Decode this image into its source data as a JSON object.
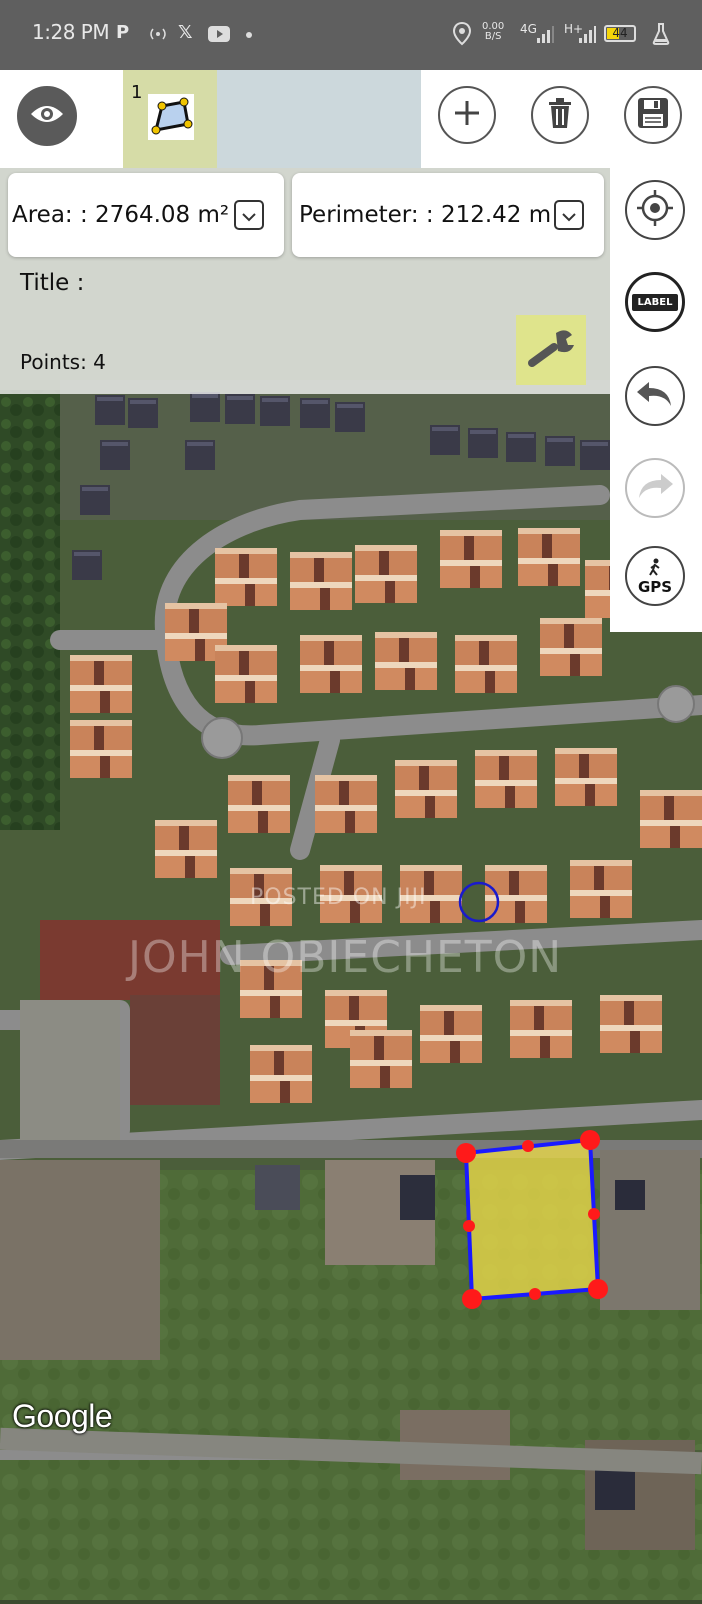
{
  "status_bar": {
    "time": "1:28 PM",
    "icons": [
      "p-app-icon",
      "radio-icon",
      "x-icon",
      "youtube-icon",
      "dot-icon"
    ],
    "net_speed_value": "0.00",
    "net_speed_unit": "B/S",
    "network": "4G",
    "network2": "H+",
    "battery": "44"
  },
  "toolbar": {
    "shape_number": "1"
  },
  "info": {
    "area": "Area: : 2764.08 m²",
    "perimeter": "Perimeter: : 212.42 m",
    "title": "Title :",
    "points": "Points: 4"
  },
  "right_panel": {
    "label_button": "LABEL",
    "gps_button": "GPS"
  },
  "map": {
    "watermark_line1": "POSTED ON JIJI",
    "watermark_line2": "JOHN OBIECHETON",
    "provider_logo": "Google",
    "polygon_fill_color": "#e8d84a",
    "polygon_stroke_color": "#1a1aff",
    "vertex_color": "#ff1a1a"
  }
}
